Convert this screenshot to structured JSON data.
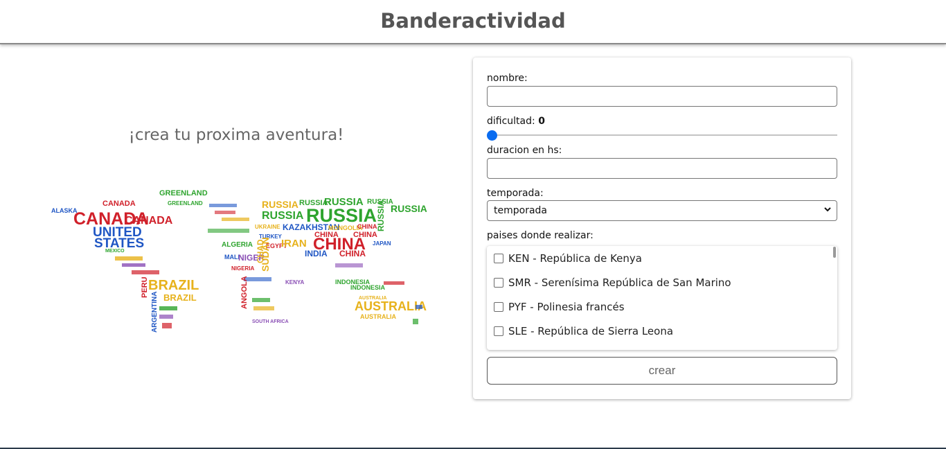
{
  "header": {
    "title": "Banderactividad"
  },
  "hero": {
    "tagline": "¡crea tu proxima aventura!",
    "map_words": {
      "canada": "CANADA",
      "usa1": "UNITED",
      "usa2": "STATES",
      "alaska": "ALASKA",
      "greenland": "GREENLAND",
      "mexico": "MEXICO",
      "brazil": "BRAZIL",
      "peru": "PERU",
      "argentina": "ARGENTINA",
      "russia": "RUSSIA",
      "china": "CHINA",
      "kazakhstan": "KAZAKHSTAN",
      "mongolia": "MONGOLIA",
      "india": "INDIA",
      "iran": "IRAN",
      "algeria": "ALGERIA",
      "niger": "NIGER",
      "chad": "CHAD",
      "sudan": "SUDAN",
      "mali": "MALI",
      "nigeria": "NIGERIA",
      "angola": "ANGOLA",
      "indonesia": "INDONESIA",
      "australia": "AUSTRALIA",
      "japan": "JAPAN",
      "turkey": "TURKEY",
      "ukraine": "UKRAINE",
      "egypt": "EGYPT",
      "kenya": "KENYA",
      "south_africa": "SOUTH AFRICA"
    }
  },
  "form": {
    "name_label": "nombre:",
    "name_value": "",
    "difficulty_label": "dificultad:",
    "difficulty_value": "0",
    "difficulty_level": 0,
    "duration_label": "duracion en hs:",
    "duration_value": "",
    "season_label": "temporada:",
    "season_selected": "temporada",
    "countries_label": "paises donde realizar:",
    "countries": [
      "KEN - República de Kenya",
      "SMR - Serenísima República de San Marino",
      "PYF - Polinesia francés",
      "SLE - República de Sierra Leona"
    ],
    "submit_label": "crear"
  },
  "colors": {
    "accent": "#0a6cf0",
    "title": "#555555",
    "map_red": "#d0202a",
    "map_blue": "#1f56c4",
    "map_green": "#2ea42e",
    "map_yellow": "#e7b21c",
    "map_purple": "#8a4fb5"
  },
  "icons": {
    "select_arrow": "chevron-down-icon"
  }
}
